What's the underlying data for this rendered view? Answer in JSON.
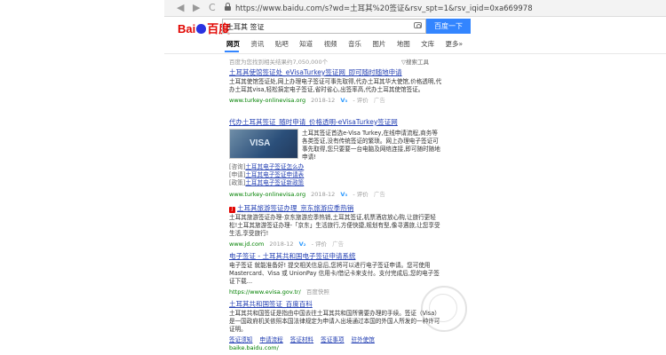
{
  "browser": {
    "nav_back": "◀",
    "nav_forward": "▶",
    "nav_reload": "C",
    "url": "https://www.baidu.com/s?wd=土耳其%20签证&rsv_spt=1&rsv_iqid=0xa669978"
  },
  "header": {
    "logo_prefix": "Bai",
    "logo_suffix": "百度",
    "search_value": "土耳其 签证",
    "search_button": "百度一下"
  },
  "tabs": [
    "网页",
    "资讯",
    "贴吧",
    "知道",
    "视频",
    "音乐",
    "图片",
    "地图",
    "文库",
    "更多»"
  ],
  "stats": "百度为您找到相关结果约7,050,000个",
  "tools": "▽搜索工具",
  "results": [
    {
      "title": "土耳其使馆签证处_eVisaTurkey签证网_即可随时随地申请",
      "desc": "土耳其使馆签证处,网上办理电子签证可事先取得,代办土耳其华大使馆,价格透明,代办土耳其visa,轻松搞定电子签证,省时省心,出签率高,代办土耳其使馆签证。",
      "url": "www.turkey-onlinevisa.org",
      "date": "2018-12",
      "v": "V₃",
      "rating": "- 评价",
      "ad": "广告"
    },
    {
      "title": "代办土耳其签证_随时申请_价格透明-eVisaTurkey签证网",
      "desc": "土耳其签证首选e-Visa Turkey,在线申请流程,商务等各类签证,没有传统签证的繁琐。网上办理电子签证可事先取得,您只要要一台电脑及网络连接,即可随时随地申请!",
      "sublinks": [
        {
          "tag": "[咨询]",
          "text": "土耳其电子签证怎么办"
        },
        {
          "tag": "[申请]",
          "text": "土耳其电子签证申请表"
        },
        {
          "tag": "[政策]",
          "text": "土耳其电子签证新政策"
        }
      ],
      "url": "www.turkey-onlinevisa.org",
      "date": "2018-12",
      "v": "V₃",
      "rating": "- 评价",
      "ad": "广告"
    },
    {
      "title": "土耳其旅游签证办理_京东旅游应季热销",
      "desc": "土耳其旅游签证办理-京东旅游应季热销,土耳其签证,机票酒店放心购,让旅行更轻松!土耳其旅游签证办理-「京东」生活旅行,方便快捷,规划有型,像寻遇旅,让您享受生活,享受旅行!",
      "url": "www.jd.com",
      "date": "2018-12",
      "v": "V₂",
      "rating": "- 评价",
      "ad": "广告"
    },
    {
      "title": "电子签证 - 土耳其共和国电子签证申请系统",
      "desc": "电子签证 就能准备好! 提交相关信息后,您将可以进行电子签证申请。您可使用Mastercard、Visa 或 UnionPay 信用卡/借记卡来支付。支付完成后,您的电子签证下载...",
      "url": "https://www.evisa.gov.tr/",
      "snapshot": "百度快照"
    },
    {
      "title": "土耳其共和国签证_百度百科",
      "desc": "土耳其共和国签证是指由中国去往土耳其共和国所需要办理的手续。签证（Visa）是一国政府机关依照本国法律规定为申请入出境通过本国的外国人所发的一种许可证明。",
      "links": [
        "签证须知",
        "申请流程",
        "签证材料",
        "签证事项",
        "驻外使馆"
      ],
      "url": "baike.baidu.com/"
    }
  ]
}
